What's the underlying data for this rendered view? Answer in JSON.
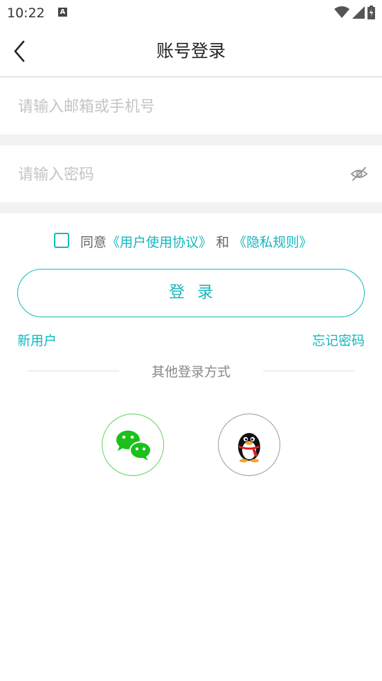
{
  "status_bar": {
    "time": "10:22",
    "notification_badge": "A"
  },
  "nav": {
    "title": "账号登录",
    "back_icon": "chevron-left-icon"
  },
  "account_input": {
    "placeholder": "请输入邮箱或手机号",
    "value": ""
  },
  "password_input": {
    "placeholder": "请输入密码",
    "value": "",
    "toggle_icon": "eye-off-icon"
  },
  "agreement": {
    "checked": false,
    "prefix": "同意",
    "user_agreement": "《用户使用协议》",
    "conjunction": "和",
    "privacy_policy": "《隐私规则》"
  },
  "login_button": {
    "label": "登录"
  },
  "links": {
    "new_user": "新用户",
    "forgot_password": "忘记密码"
  },
  "other_login": {
    "title": "其他登录方式",
    "options": [
      "wechat-icon",
      "qq-icon"
    ]
  },
  "colors": {
    "accent": "#13b8bf",
    "wechat": "#19c11a",
    "qq_border": "#9a9a9a",
    "band": "#f2f2f2"
  }
}
